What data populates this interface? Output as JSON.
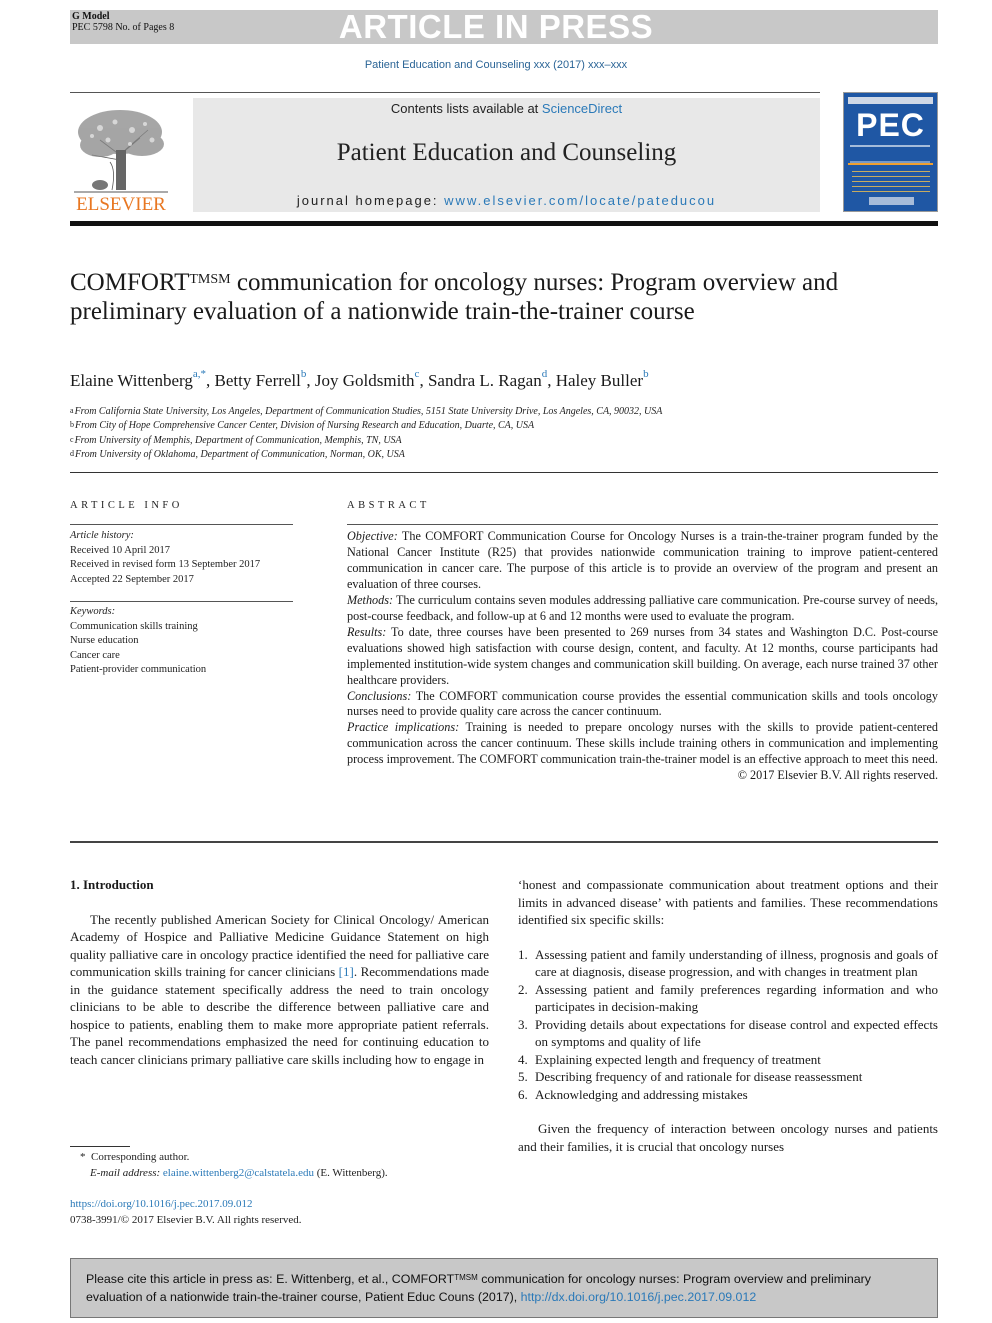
{
  "banner": {
    "model_line1": "G Model",
    "model_line2": "PEC 5798 No. of Pages 8",
    "status": "ARTICLE IN PRESS"
  },
  "journal_ref": "Patient Education and Counseling xxx (2017) xxx–xxx",
  "masthead": {
    "publisher": "ELSEVIER",
    "contents_prefix": "Contents lists available at ",
    "contents_link": "ScienceDirect",
    "journal_title": "Patient Education and Counseling",
    "homepage_prefix": "journal homepage: ",
    "homepage_link": "www.elsevier.com/locate/pateducou",
    "cover_label": "PEC"
  },
  "article": {
    "title_main": "COMFORT",
    "title_sup": "TMSM",
    "title_rest": " communication for oncology nurses: Program overview and preliminary evaluation of a nationwide train-the-trainer course",
    "authors": [
      {
        "name": "Elaine Wittenberg",
        "sup": "a,*"
      },
      {
        "name": "Betty Ferrell",
        "sup": "b"
      },
      {
        "name": "Joy Goldsmith",
        "sup": "c"
      },
      {
        "name": "Sandra L. Ragan",
        "sup": "d"
      },
      {
        "name": "Haley Buller",
        "sup": "b"
      }
    ],
    "affiliations": [
      {
        "key": "a",
        "text": "From California State University, Los Angeles, Department of Communication Studies, 5151 State University Drive, Los Angeles, CA, 90032, USA"
      },
      {
        "key": "b",
        "text": "From City of Hope Comprehensive Cancer Center, Division of Nursing Research and Education, Duarte, CA, USA"
      },
      {
        "key": "c",
        "text": "From University of Memphis, Department of Communication, Memphis, TN, USA"
      },
      {
        "key": "d",
        "text": "From University of Oklahoma, Department of Communication, Norman, OK, USA"
      }
    ]
  },
  "article_info": {
    "heading": "ARTICLE INFO",
    "history_label": "Article history:",
    "history": [
      "Received 10 April 2017",
      "Received in revised form 13 September 2017",
      "Accepted 22 September 2017"
    ],
    "keywords_label": "Keywords:",
    "keywords": [
      "Communication skills training",
      "Nurse education",
      "Cancer care",
      "Patient-provider communication"
    ]
  },
  "abstract": {
    "heading": "ABSTRACT",
    "sections": [
      {
        "label": "Objective:",
        "text": " The COMFORT Communication Course for Oncology Nurses is a train-the-trainer program funded by the National Cancer Institute (R25) that provides nationwide communication training to improve patient-centered communication in cancer care. The purpose of this article is to provide an overview of the program and present an evaluation of three courses."
      },
      {
        "label": "Methods:",
        "text": " The curriculum contains seven modules addressing palliative care communication. Pre-course survey of needs, post-course feedback, and follow-up at 6 and 12 months were used to evaluate the program."
      },
      {
        "label": "Results:",
        "text": " To date, three courses have been presented to 269 nurses from 34 states and Washington D.C. Post-course evaluations showed high satisfaction with course design, content, and faculty. At 12 months, course participants had implemented institution-wide system changes and communication skill building. On average, each nurse trained 37 other healthcare providers."
      },
      {
        "label": "Conclusions:",
        "text": " The COMFORT communication course provides the essential communication skills and tools oncology nurses need to provide quality care across the cancer continuum."
      },
      {
        "label": "Practice implications:",
        "text": " Training is needed to prepare oncology nurses with the skills to provide patient-centered communication across the cancer continuum. These skills include training others in communication and implementing process improvement. The COMFORT communication train-the-trainer model is an effective approach to meet this need."
      }
    ],
    "copyright": "© 2017 Elsevier B.V. All rights reserved."
  },
  "body": {
    "section_heading": "1. Introduction",
    "para1_before": "The recently published American Society for Clinical Oncology/ American Academy of Hospice and Palliative Medicine Guidance Statement on high quality palliative care in oncology practice identified the need for palliative care communication skills training for cancer clinicians ",
    "para1_cite": "[1]",
    "para1_after": ". Recommendations made in the guidance statement specifically address the need to train oncology clinicians to be able to describe the difference between palliative care and hospice to patients, enabling them to make more appropriate patient referrals. The panel recommendations emphasized the need for continuing education to teach cancer clinicians primary palliative care skills including how to engage in",
    "para2": "‘honest and compassionate communication about treatment options and their limits in advanced disease’ with patients and families. These recommendations identified six specific skills:",
    "skills": [
      {
        "num": "1.",
        "text": "Assessing patient and family understanding of illness, prognosis and goals of care at diagnosis, disease progression, and with changes in treatment plan"
      },
      {
        "num": "2.",
        "text": "Assessing patient and family preferences regarding information and who participates in decision-making"
      },
      {
        "num": "3.",
        "text": "Providing details about expectations for disease control and expected effects on symptoms and quality of life"
      },
      {
        "num": "4.",
        "text": "Explaining expected length and frequency of treatment"
      },
      {
        "num": "5.",
        "text": "Describing frequency of and rationale for disease reassessment"
      },
      {
        "num": "6.",
        "text": "Acknowledging and addressing mistakes"
      }
    ],
    "para3": "Given the frequency of interaction between oncology nurses and patients and their families, it is crucial that oncology nurses"
  },
  "footnotes": {
    "star": "*",
    "corresponding": "Corresponding author.",
    "email_label": "E-mail address:",
    "email": "elaine.wittenberg2@calstatela.edu",
    "email_suffix": " (E. Wittenberg).",
    "doi_link": "https://doi.org/10.1016/j.pec.2017.09.012",
    "issn": "0738-3991/© 2017 Elsevier B.V. All rights reserved."
  },
  "cite_box": {
    "prefix": "Please cite this article in press as: E. Wittenberg, et al., COMFORT",
    "sup": "TMSM",
    "rest": " communication for oncology nurses: Program overview and preliminary evaluation of a nationwide train-the-trainer course, Patient Educ Couns (2017), ",
    "link": "http://dx.doi.org/10.1016/j.pec.2017.09.012"
  },
  "colors": {
    "link": "#2a79b8",
    "elsevier_orange": "#e87722",
    "banner_gray": "#c8c8c8",
    "cover_blue": "#1f57a4"
  }
}
